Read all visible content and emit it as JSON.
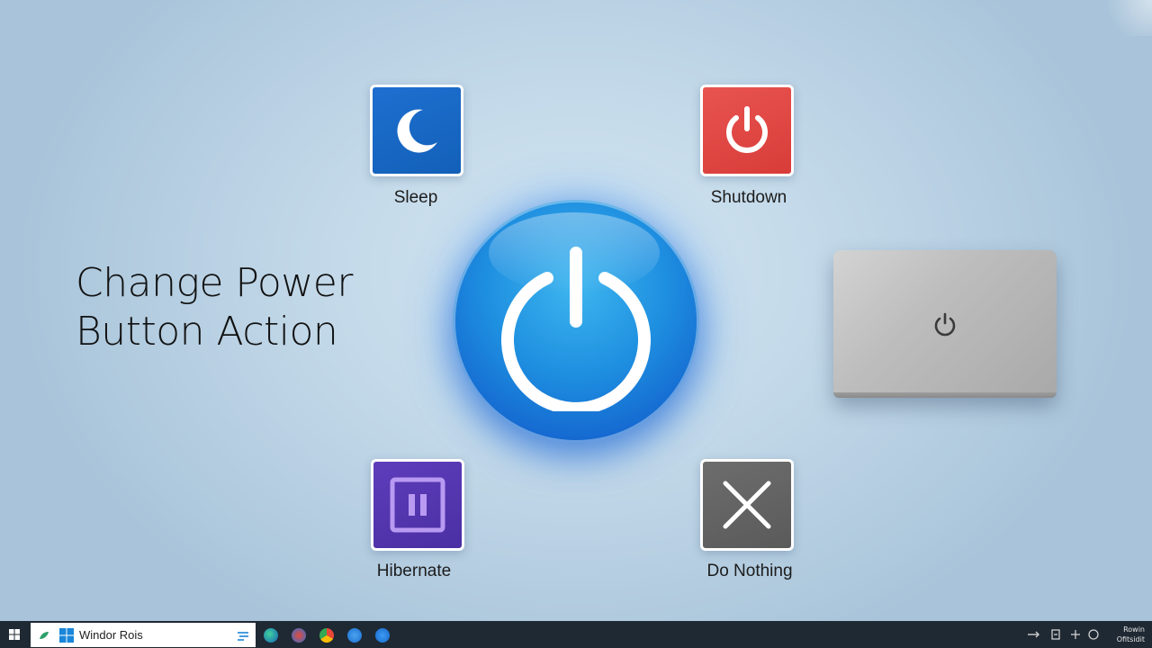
{
  "heading": {
    "line1": "Change Power",
    "line2": "Button Action"
  },
  "actions": {
    "sleep": {
      "label": "Sleep",
      "icon": "moon-icon",
      "color": "#1565c0"
    },
    "shutdown": {
      "label": "Shutdown",
      "icon": "power-icon",
      "color": "#e04845"
    },
    "hibernate": {
      "label": "Hibernate",
      "icon": "pause-icon",
      "color": "#5235ad"
    },
    "nothing": {
      "label": "Do Nothing",
      "icon": "close-icon",
      "color": "#636363"
    }
  },
  "center": {
    "icon": "power-button-icon",
    "color": "#1e8fe0"
  },
  "laptop": {
    "icon": "power-icon"
  },
  "taskbar": {
    "search_text": "Windor Rois",
    "apps": [
      "edge-icon",
      "mail-icon",
      "chrome-icon",
      "store-icon",
      "explorer-icon"
    ],
    "tray_line1": "Rowin",
    "tray_line2": "Ofitsidit"
  }
}
